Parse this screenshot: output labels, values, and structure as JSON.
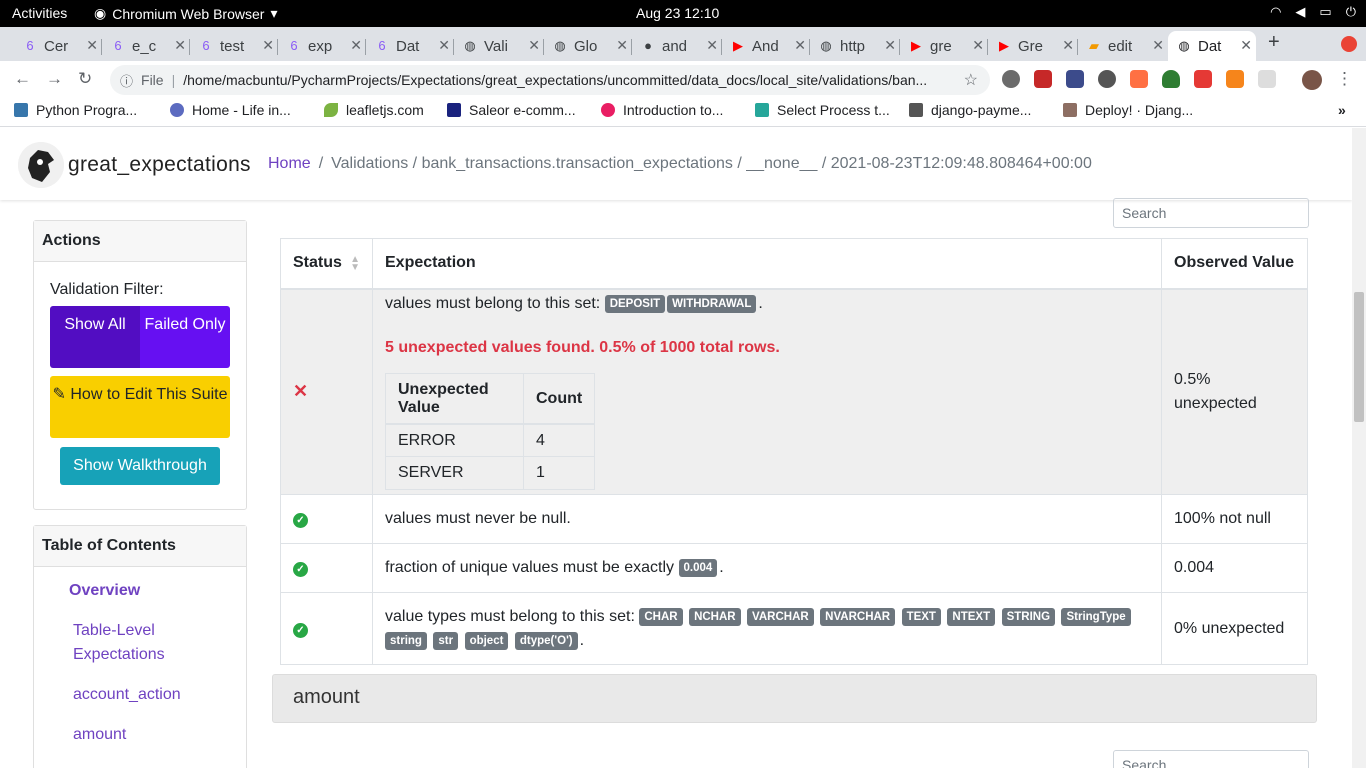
{
  "os": {
    "activities": "Activities",
    "app_name": "Chromium Web Browser",
    "clock": "Aug 23  12:10"
  },
  "tabs": [
    {
      "label": "Cer",
      "icon": "ge"
    },
    {
      "label": "e_c",
      "icon": "ge"
    },
    {
      "label": "test",
      "icon": "ge"
    },
    {
      "label": "exp",
      "icon": "ge"
    },
    {
      "label": "Dat",
      "icon": "ge"
    },
    {
      "label": "Vali",
      "icon": "globe"
    },
    {
      "label": "Glo",
      "icon": "globe"
    },
    {
      "label": "and",
      "icon": "github"
    },
    {
      "label": "And",
      "icon": "youtube"
    },
    {
      "label": "http",
      "icon": "globe"
    },
    {
      "label": "gre",
      "icon": "youtube"
    },
    {
      "label": "Gre",
      "icon": "youtube"
    },
    {
      "label": "edit",
      "icon": "book"
    },
    {
      "label": "Dat",
      "icon": "globe"
    }
  ],
  "address_bar": {
    "scheme": "File",
    "url": "/home/macbuntu/PycharmProjects/Expectations/great_expectations/uncommitted/data_docs/local_site/validations/ban..."
  },
  "bookmarks": [
    "Python Progra...",
    "Home - Life in...",
    "leafletjs.com",
    "Saleor e-comm...",
    "Introduction to...",
    "Select Process t...",
    "django-payme...",
    "Deploy! · Djang..."
  ],
  "header": {
    "brand": "great_expectations",
    "home": "Home",
    "path": "Validations / bank_transactions.transaction_expectations / __none__ / 2021-08-23T12:09:48.808464+00:00"
  },
  "actions": {
    "title": "Actions",
    "filter_label": "Validation Filter:",
    "show_all": "Show All",
    "failed_only": "Failed Only",
    "edit_label": "How to Edit This Suite",
    "walkthrough": "Show Walkthrough"
  },
  "toc": {
    "title": "Table of Contents",
    "items": [
      "Overview",
      "Table-Level Expectations",
      "account_action",
      "amount"
    ]
  },
  "search_placeholder": "Search",
  "table": {
    "headers": [
      "Status",
      "Expectation",
      "Observed Value"
    ],
    "row1": {
      "text": "values must belong to this set:",
      "badges": [
        "DEPOSIT",
        "WITHDRAWAL"
      ],
      "error": "5 unexpected values found. 0.5% of 1000 total rows.",
      "sub_headers": [
        "Unexpected Value",
        "Count"
      ],
      "sub_rows": [
        [
          "ERROR",
          "4"
        ],
        [
          "SERVER",
          "1"
        ]
      ],
      "observed": "0.5% unexpected"
    },
    "row2": {
      "text": "values must never be null.",
      "observed": "100% not null"
    },
    "row3": {
      "text": "fraction of unique values must be exactly",
      "badge": "0.004",
      "observed": "0.004"
    },
    "row4": {
      "text": "value types must belong to this set:",
      "badges": [
        "CHAR",
        "NCHAR",
        "VARCHAR",
        "NVARCHAR",
        "TEXT",
        "NTEXT",
        "STRING",
        "StringType",
        "string",
        "str",
        "object",
        "dtype('O')"
      ],
      "observed": "0% unexpected"
    }
  },
  "section_title": "amount"
}
